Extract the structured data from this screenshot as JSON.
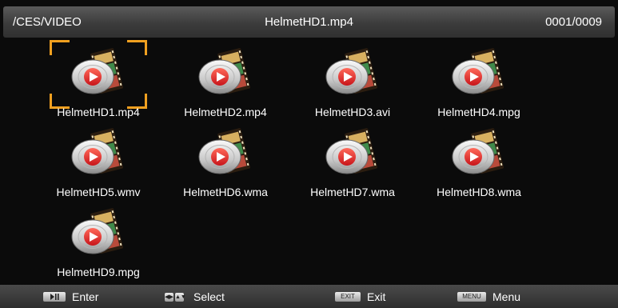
{
  "header": {
    "path": "/CES/VIDEO",
    "title": "HelmetHD1.mp4",
    "counter": "0001/0009"
  },
  "files": [
    {
      "name": "HelmetHD1.mp4",
      "selected": true
    },
    {
      "name": "HelmetHD2.mp4",
      "selected": false
    },
    {
      "name": "HelmetHD3.avi",
      "selected": false
    },
    {
      "name": "HelmetHD4.mpg",
      "selected": false
    },
    {
      "name": "HelmetHD5.wmv",
      "selected": false
    },
    {
      "name": "HelmetHD6.wma",
      "selected": false
    },
    {
      "name": "HelmetHD7.wma",
      "selected": false
    },
    {
      "name": "HelmetHD8.wma",
      "selected": false
    },
    {
      "name": "HelmetHD9.mpg",
      "selected": false
    }
  ],
  "file_icon": "video-file-icon",
  "focus_color": "#f0a020",
  "footer": {
    "enter": {
      "key_icon": "play-pause-key-icon",
      "label": "Enter"
    },
    "select": {
      "key_icon": "arrow-keys-icon",
      "label": "Select"
    },
    "exit": {
      "key_text": "EXIT",
      "label": "Exit"
    },
    "menu": {
      "key_text": "MENU",
      "label": "Menu"
    }
  }
}
